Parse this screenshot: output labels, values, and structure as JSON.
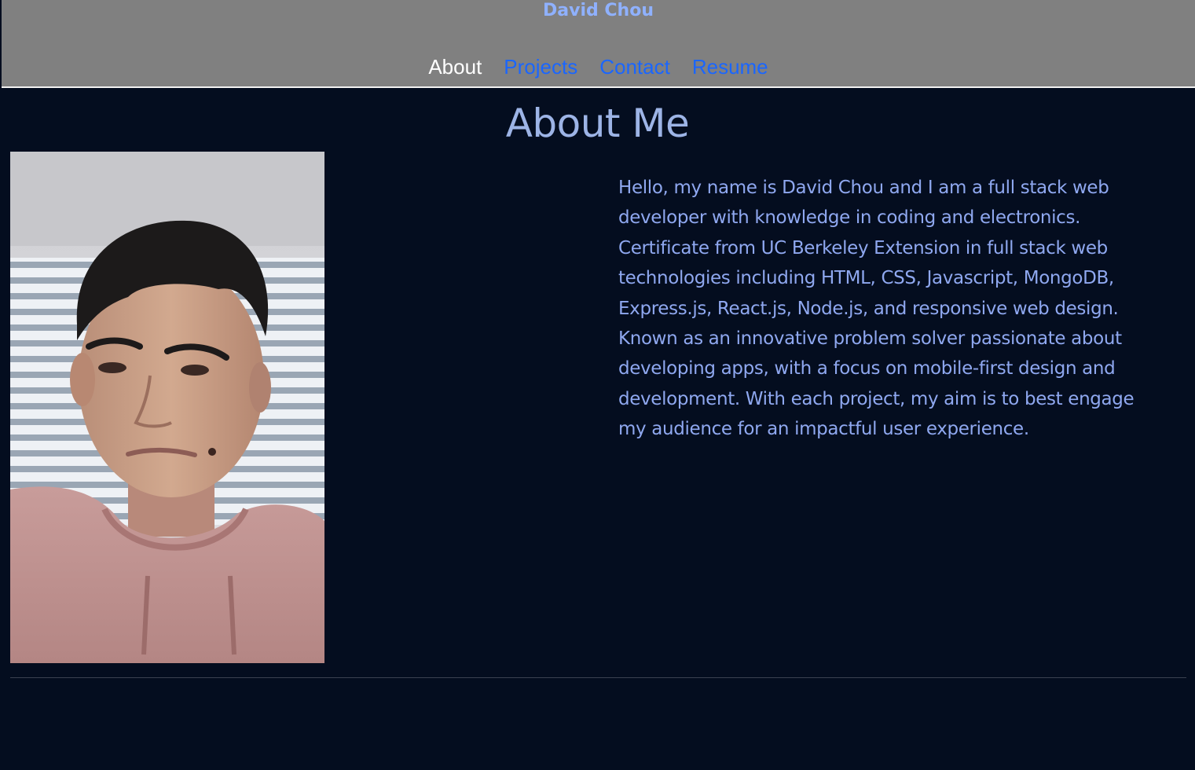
{
  "header": {
    "site_title": "David Chou",
    "nav": [
      {
        "label": "About",
        "active": true
      },
      {
        "label": "Projects",
        "active": false
      },
      {
        "label": "Contact",
        "active": false
      },
      {
        "label": "Resume",
        "active": false
      }
    ]
  },
  "main": {
    "heading": "About Me",
    "bio": "Hello, my name is David Chou and I am a full stack web developer with knowledge in coding and electronics. Certificate from UC Berkeley Extension in full stack web technologies including HTML, CSS, Javascript, MongoDB, Express.js, React.js, Node.js, and responsive web design. Known as an innovative problem solver passionate about developing apps, with a focus on mobile-first design and development. With each project, my aim is to best engage my audience for an impactful user experience."
  },
  "colors": {
    "page_background": "#040d1f",
    "header_background": "#808080",
    "site_title": "#8fb1ff",
    "nav_link": "#1a66ff",
    "nav_active": "#ffffff",
    "heading_text": "#9db4e6",
    "bio_text": "#8fa8f0"
  }
}
